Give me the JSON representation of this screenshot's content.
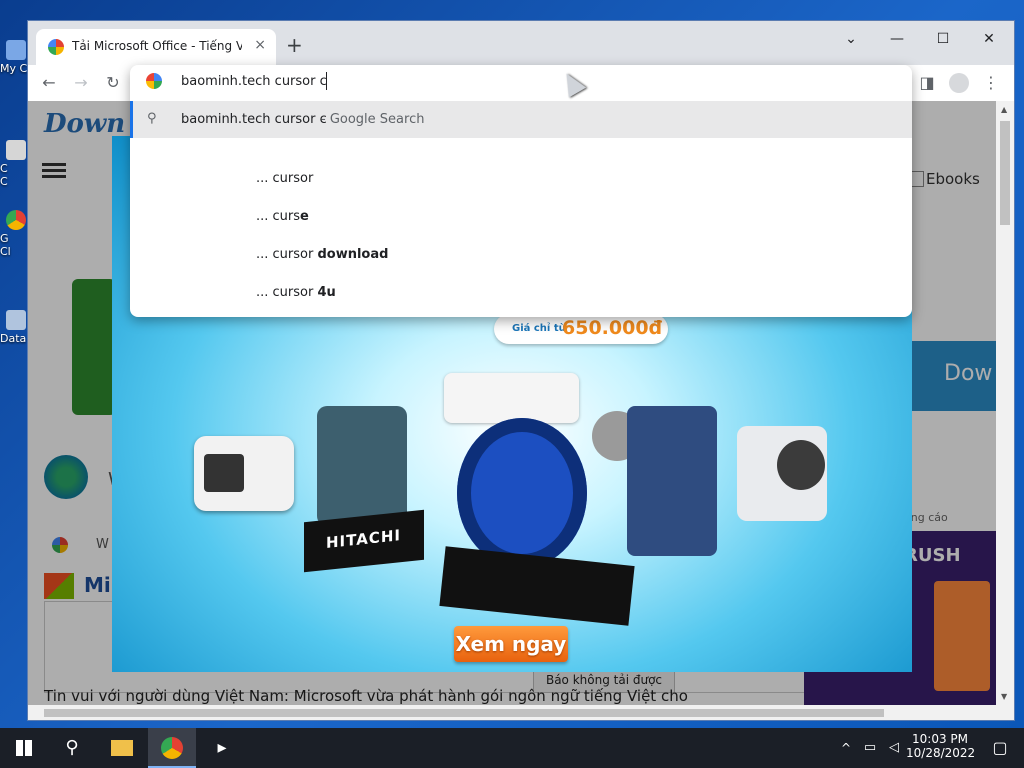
{
  "desktop": {
    "icons": [
      {
        "label": "My C"
      },
      {
        "label": "C\nC"
      },
      {
        "label": "G\nCl"
      },
      {
        "label": "Data"
      }
    ]
  },
  "browser": {
    "tab_title": "Tải Microsoft Office - Tiếng Việt",
    "new_tab": "+",
    "close_tab": "×",
    "window_controls": {
      "dropdown": "⌄",
      "minimize": "—",
      "maximize": "☐",
      "close": "✕"
    },
    "address_text": "baominh.tech cursor c",
    "omnibox": {
      "search_suggestion": "baominh.tech cursor c",
      "search_suffix": " - Google Search",
      "suggestions": [
        {
          "prefix": "... cursor",
          "bold": ""
        },
        {
          "prefix": "... curs",
          "bold": "e"
        },
        {
          "prefix": "... cursor ",
          "bold": "download"
        },
        {
          "prefix": "... cursor ",
          "bold": "4u"
        }
      ]
    }
  },
  "page": {
    "ebooks": "Ebooks",
    "report_btn": "Báo không tải được",
    "ad_label": "âng cáo",
    "rush": "RUSH",
    "dow": "Dow",
    "news_line": "Tin vui với người dùng Việt Nam: Microsoft vừa phát hành gói ngôn ngữ tiếng Việt cho",
    "mi": "Mi",
    "w1": "W",
    "w2": "W"
  },
  "ad": {
    "price_prefix": "Giá chỉ từ",
    "price": "650.000đ",
    "cta": "Xem ngay",
    "brand": "HITACHI"
  },
  "taskbar": {
    "time": "10:03 PM",
    "date": "10/28/2022"
  }
}
